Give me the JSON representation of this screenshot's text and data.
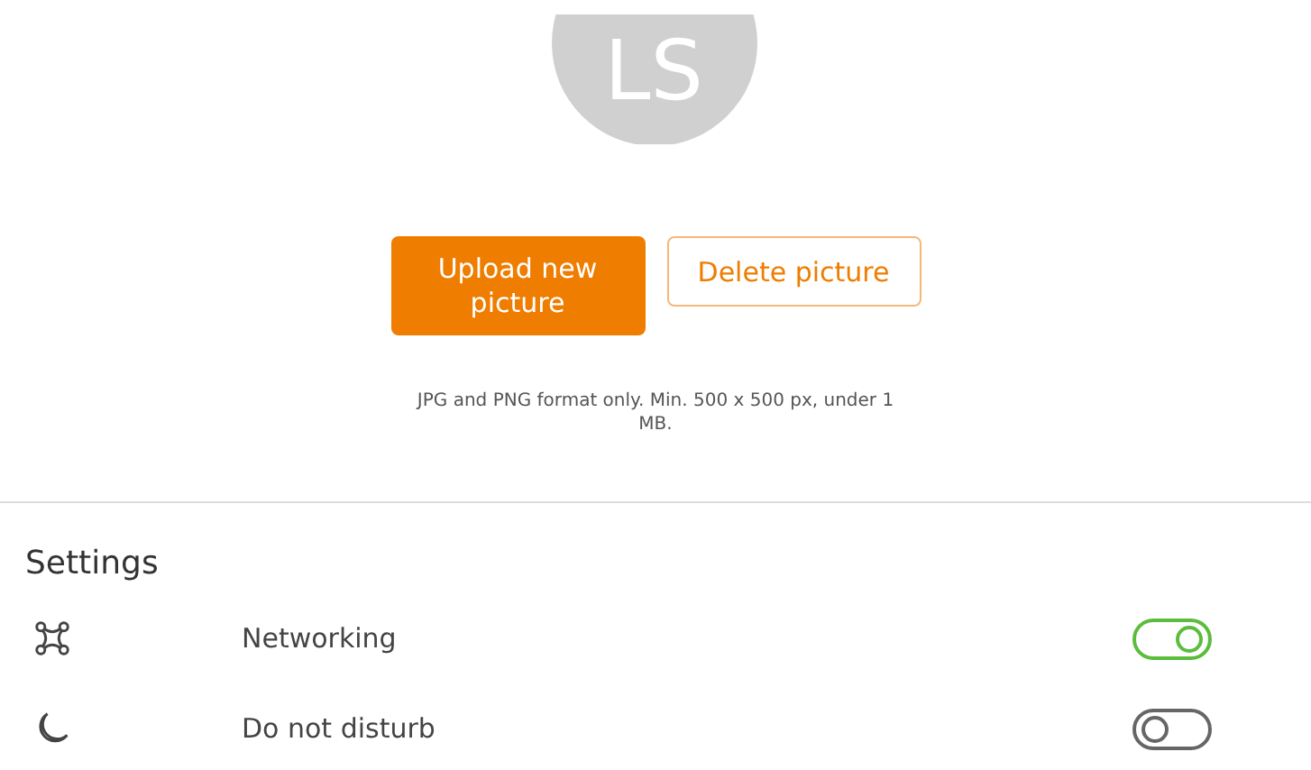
{
  "avatar": {
    "initials": "LS"
  },
  "buttons": [
    {
      "label": "Upload new picture",
      "kind": "primary"
    },
    {
      "label": "Delete picture",
      "kind": "secondary"
    }
  ],
  "hint": "JPG and PNG format only. Min. 500 x 500 px, under 1 MB.",
  "settings": {
    "title": "Settings",
    "items": [
      {
        "kind": "network",
        "label": "Networking",
        "on": true
      },
      {
        "kind": "moon",
        "label": "Do not disturb",
        "on": false
      }
    ]
  }
}
